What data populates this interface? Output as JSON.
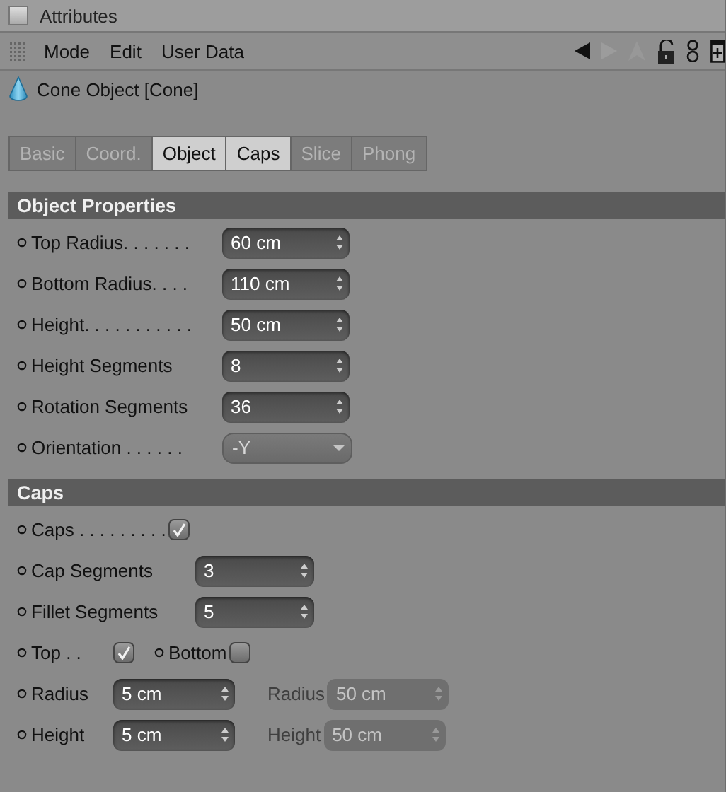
{
  "panel": {
    "title": "Attributes"
  },
  "menu": [
    "Mode",
    "Edit",
    "User Data"
  ],
  "object": {
    "title": "Cone Object [Cone]"
  },
  "tabs": [
    {
      "label": "Basic",
      "selected": false
    },
    {
      "label": "Coord.",
      "selected": false
    },
    {
      "label": "Object",
      "selected": true
    },
    {
      "label": "Caps",
      "selected": true
    },
    {
      "label": "Slice",
      "selected": false
    },
    {
      "label": "Phong",
      "selected": false
    }
  ],
  "sections": [
    {
      "title": "Object Properties",
      "rows": [
        {
          "items": [
            {
              "kind": "number",
              "label": "Top Radius. . . . . . .",
              "value": "60 cm",
              "disabled": false
            }
          ]
        },
        {
          "items": [
            {
              "kind": "number",
              "label": "Bottom Radius. . . .",
              "value": "110 cm",
              "disabled": false
            }
          ]
        },
        {
          "items": [
            {
              "kind": "number",
              "label": "Height. . . . . . . . . . .",
              "value": "50 cm",
              "disabled": false
            }
          ]
        },
        {
          "items": [
            {
              "kind": "number",
              "label": "Height Segments",
              "value": "8",
              "disabled": false
            }
          ]
        },
        {
          "items": [
            {
              "kind": "number",
              "label": "Rotation Segments",
              "value": "36",
              "disabled": false
            }
          ]
        },
        {
          "items": [
            {
              "kind": "dropdown",
              "label": "Orientation . . . . . .",
              "value": "-Y",
              "disabled": false
            }
          ]
        }
      ]
    },
    {
      "title": "Caps",
      "rows": [
        {
          "items": [
            {
              "kind": "checkbox",
              "label": "Caps . . . . . . . . .",
              "checked": true,
              "disabled": false
            }
          ]
        },
        {
          "items": [
            {
              "kind": "number",
              "label": "Cap Segments",
              "value": "3",
              "disabled": false
            }
          ]
        },
        {
          "items": [
            {
              "kind": "number",
              "label": "Fillet Segments",
              "value": "5",
              "disabled": false
            }
          ]
        },
        {
          "items": [
            {
              "kind": "checkbox",
              "label": "Top . .",
              "checked": true,
              "disabled": false
            },
            {
              "kind": "checkbox",
              "label": "Bottom",
              "checked": false,
              "disabled": false
            }
          ]
        },
        {
          "items": [
            {
              "kind": "number",
              "label": "Radius",
              "value": "5 cm",
              "disabled": false
            },
            {
              "kind": "number",
              "label": "Radius",
              "value": "50 cm",
              "disabled": true
            }
          ]
        },
        {
          "items": [
            {
              "kind": "number",
              "label": "Height",
              "value": "5 cm",
              "disabled": false
            },
            {
              "kind": "number",
              "label": "Height",
              "value": "50 cm",
              "disabled": true
            }
          ]
        }
      ]
    }
  ]
}
